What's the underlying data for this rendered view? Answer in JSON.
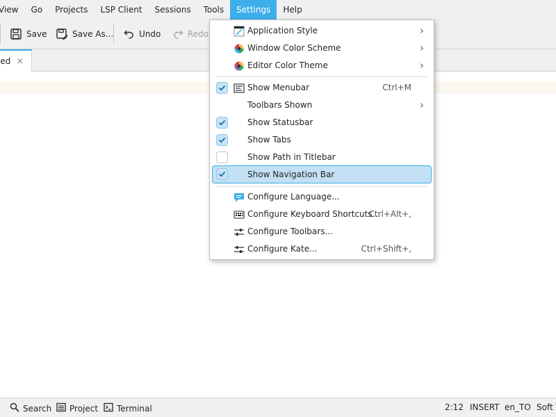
{
  "menubar": {
    "items": [
      "View",
      "Go",
      "Projects",
      "LSP Client",
      "Sessions",
      "Tools",
      "Settings",
      "Help"
    ],
    "active": "Settings"
  },
  "toolbar": {
    "save_label": "Save",
    "save_as_label": "Save As...",
    "undo_label": "Undo",
    "redo_label": "Redo"
  },
  "tab": {
    "label": "led",
    "close": "×"
  },
  "settings_menu": {
    "application_style": "Application Style",
    "window_color_scheme": "Window Color Scheme",
    "editor_color_theme": "Editor Color Theme",
    "show_menubar": "Show Menubar",
    "show_menubar_shortcut": "Ctrl+M",
    "toolbars_shown": "Toolbars Shown",
    "show_statusbar": "Show Statusbar",
    "show_tabs": "Show Tabs",
    "show_path_in_titlebar": "Show Path in Titlebar",
    "show_navigation_bar": "Show Navigation Bar",
    "configure_language": "Configure Language...",
    "configure_keyboard_shortcuts": "Configure Keyboard Shortcuts...",
    "configure_keyboard_shortcuts_shortcut": "Ctrl+Alt+,",
    "configure_toolbars": "Configure Toolbars...",
    "configure_kate": "Configure Kate...",
    "configure_kate_shortcut": "Ctrl+Shift+,",
    "checked": {
      "show_menubar": true,
      "show_statusbar": true,
      "show_tabs": true,
      "show_path_in_titlebar": false,
      "show_navigation_bar": true
    },
    "highlighted_item": "Show Navigation Bar"
  },
  "statusbar": {
    "search_label": "Search",
    "project_label": "Project",
    "terminal_label": "Terminal",
    "cursor_position": "2:12",
    "mode": "INSERT",
    "language": "en_TO",
    "tabs_mode": "Soft T"
  },
  "colors": {
    "accent": "#3daee9",
    "highlight": "#c3e0f4",
    "chrome": "#eff0f1"
  }
}
